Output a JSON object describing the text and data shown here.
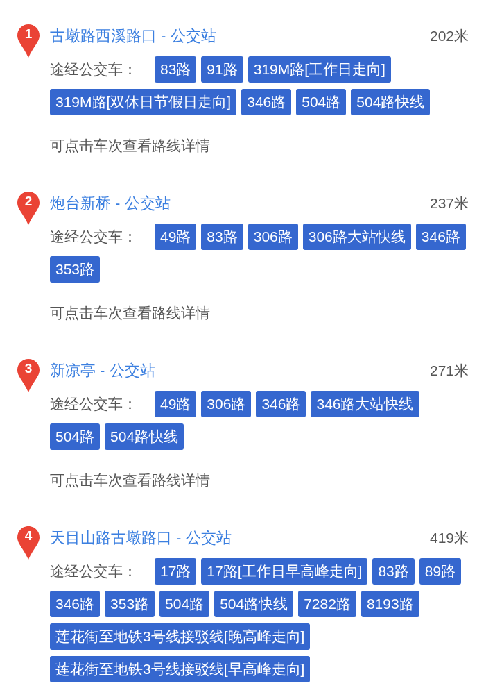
{
  "stations": [
    {
      "index": "1",
      "name": "古墩路西溪路口 - 公交站",
      "distance": "202米",
      "label": "途经公交车：",
      "routes": [
        "83路",
        "91路",
        "319M路[工作日走向]",
        "319M路[双休日节假日走向]",
        "346路",
        "504路",
        "504路快线"
      ],
      "hint": "可点击车次查看路线详情"
    },
    {
      "index": "2",
      "name": "炮台新桥 - 公交站",
      "distance": "237米",
      "label": "途经公交车：",
      "routes": [
        "49路",
        "83路",
        "306路",
        "306路大站快线",
        "346路",
        "353路"
      ],
      "hint": "可点击车次查看路线详情"
    },
    {
      "index": "3",
      "name": "新凉亭 - 公交站",
      "distance": "271米",
      "label": "途经公交车：",
      "routes": [
        "49路",
        "306路",
        "346路",
        "346路大站快线",
        "504路",
        "504路快线"
      ],
      "hint": "可点击车次查看路线详情"
    },
    {
      "index": "4",
      "name": "天目山路古墩路口 - 公交站",
      "distance": "419米",
      "label": "途经公交车：",
      "routes": [
        "17路",
        "17路[工作日早高峰走向]",
        "83路",
        "89路",
        "346路",
        "353路",
        "504路",
        "504路快线",
        "7282路",
        "8193路",
        "莲花街至地铁3号线接驳线[晚高峰走向]",
        "莲花街至地铁3号线接驳线[早高峰走向]"
      ]
    }
  ]
}
